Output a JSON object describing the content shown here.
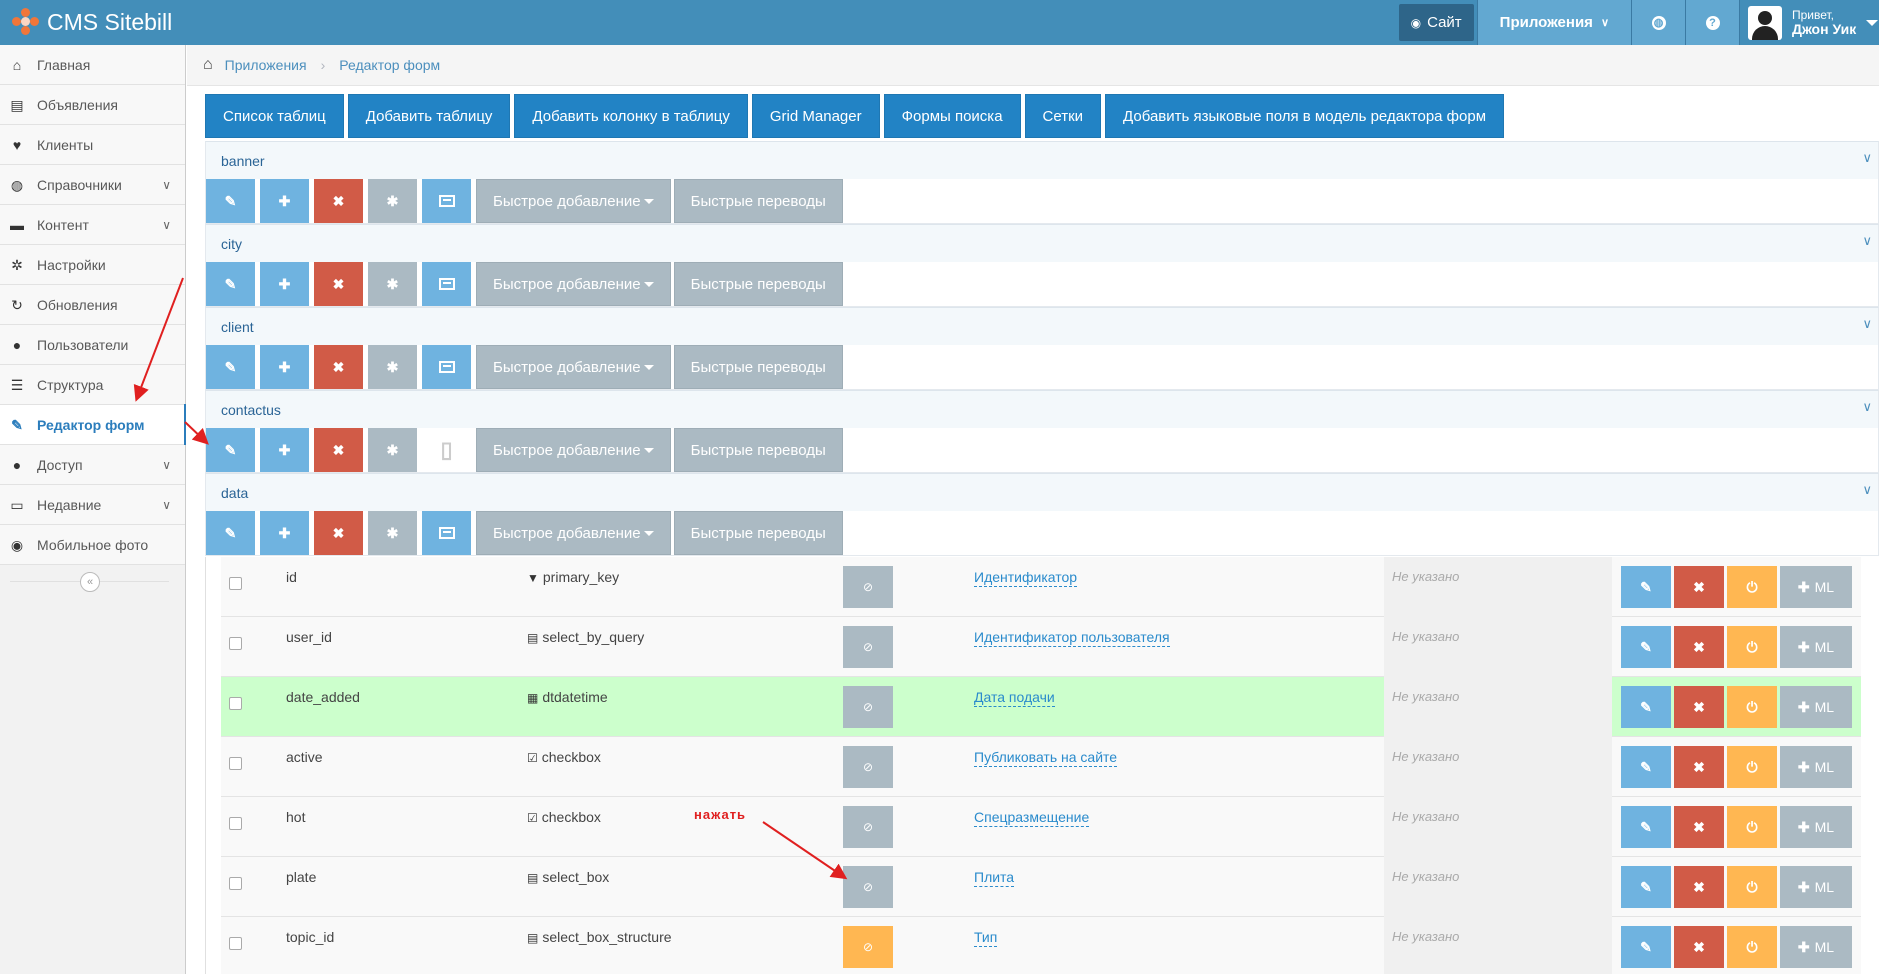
{
  "app": {
    "title": "CMS Sitebill"
  },
  "navbar": {
    "site_label": "Сайт",
    "apps_label": "Приложения",
    "greeting": "Привет,",
    "user_name": "Джон Уик"
  },
  "sidebar": {
    "items": [
      {
        "label": "Главная",
        "icon": "home-icon",
        "glyph": "⌂"
      },
      {
        "label": "Объявления",
        "icon": "book-icon",
        "glyph": "▤"
      },
      {
        "label": "Клиенты",
        "icon": "heart-icon",
        "glyph": "♥"
      },
      {
        "label": "Справочники",
        "icon": "globe-icon",
        "glyph": "◍",
        "submenu": true
      },
      {
        "label": "Контент",
        "icon": "desk-icon",
        "glyph": "▬",
        "submenu": true
      },
      {
        "label": "Настройки",
        "icon": "gears-icon",
        "glyph": "✲"
      },
      {
        "label": "Обновления",
        "icon": "refresh-icon",
        "glyph": "↻"
      },
      {
        "label": "Пользователи",
        "icon": "user-icon",
        "glyph": "●"
      },
      {
        "label": "Структура",
        "icon": "list-icon",
        "glyph": "☰"
      },
      {
        "label": "Редактор форм",
        "icon": "edit-icon",
        "glyph": "✎",
        "active": true
      },
      {
        "label": "Доступ",
        "icon": "users-icon",
        "glyph": "●",
        "submenu": true
      },
      {
        "label": "Недавние",
        "icon": "desktop-icon",
        "glyph": "▭",
        "submenu": true
      },
      {
        "label": "Мобильное фото",
        "icon": "camera-icon",
        "glyph": "◉"
      }
    ]
  },
  "breadcrumb": {
    "parent": "Приложения",
    "current": "Редактор форм"
  },
  "tabs": [
    "Список таблиц",
    "Добавить таблицу",
    "Добавить колонку в таблицу",
    "Grid Manager",
    "Формы поиска",
    "Сетки",
    "Добавить языковые поля в модель редактора форм"
  ],
  "panel_buttons": {
    "quick_add": "Быстрое добавление",
    "quick_translate": "Быстрые переводы"
  },
  "tables": [
    {
      "name": "banner"
    },
    {
      "name": "city"
    },
    {
      "name": "client"
    },
    {
      "name": "contactus",
      "no_list_button": true
    },
    {
      "name": "data"
    }
  ],
  "rows": [
    {
      "name": "id",
      "type": "primary_key",
      "type_glyph": "▼",
      "title": "Идентификатор",
      "hint": "Не указано"
    },
    {
      "name": "user_id",
      "type": "select_by_query",
      "type_glyph": "▤",
      "title": "Идентификатор пользователя",
      "hint": "Не указано"
    },
    {
      "name": "date_added",
      "type": "dtdatetime",
      "type_glyph": "▦",
      "title": "Дата подачи",
      "hint": "Не указано",
      "highlight": true
    },
    {
      "name": "active",
      "type": "checkbox",
      "type_glyph": "☑",
      "title": "Публиковать на сайте",
      "hint": "Не указано"
    },
    {
      "name": "hot",
      "type": "checkbox",
      "type_glyph": "☑",
      "title": "Спецразмещение",
      "hint": "Не указано"
    },
    {
      "name": "plate",
      "type": "select_box",
      "type_glyph": "▤",
      "title": "Плита",
      "hint": "Не указано"
    },
    {
      "name": "topic_id",
      "type": "select_box_structure",
      "type_glyph": "▤",
      "title": "Тип",
      "hint": "Не указано",
      "toggle_active": true
    }
  ],
  "ml_label": "ML",
  "annotation": {
    "text": "нажать",
    "color": "#e02020"
  },
  "colors": {
    "navbar": "#438eb9",
    "tab": "#2283c5",
    "btn_blue": "#6fb3e0",
    "btn_red": "#d15b47",
    "btn_grey": "#abbac3",
    "btn_orange": "#ffb752",
    "row_highlight": "#ccffcc"
  }
}
